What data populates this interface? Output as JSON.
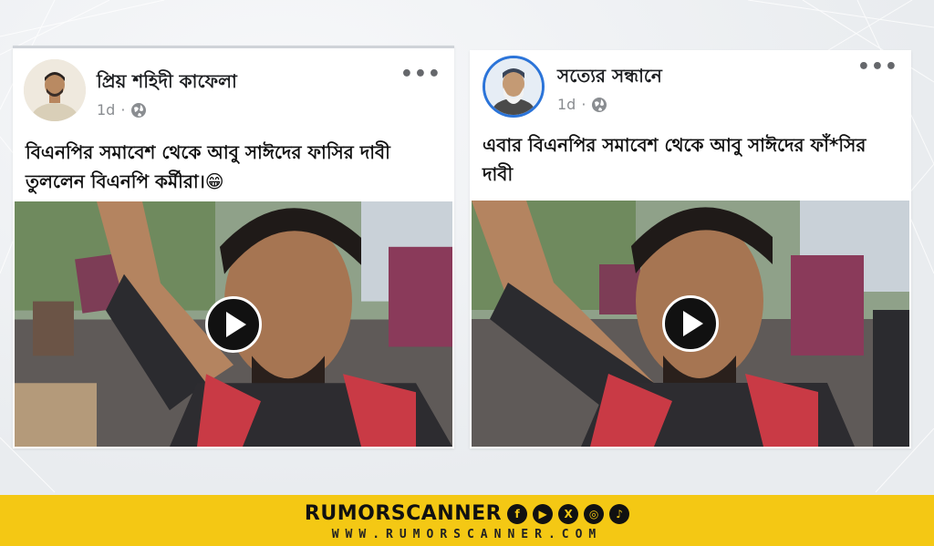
{
  "posts": [
    {
      "page_name": "প্রিয় শহিদী কাফেলা",
      "time": "1d",
      "separator": "·",
      "more_icon": "more-icon",
      "caption": "বিএনপির সমাবেশ থেকে আবু সাঈদের ফাসির দাবী তুললেন বিএনপি কর্মীরা।😁",
      "video_icon": "play-icon"
    },
    {
      "page_name": "সত্যের সন্ধানে",
      "time": "1d",
      "separator": "·",
      "more_icon": "more-icon",
      "caption": "এবার বিএনপির সমাবেশ থেকে আবু সাঈদের ফাঁ*সির দাবী",
      "video_icon": "play-icon"
    }
  ],
  "footer": {
    "brand": "RUMORSCANNER",
    "social_icons": [
      "facebook-icon",
      "youtube-icon",
      "x-icon",
      "instagram-icon",
      "tiktok-icon"
    ],
    "social_glyphs": [
      "f",
      "▶",
      "X",
      "◎",
      "♪"
    ],
    "url": "WWW.RUMORSCANNER.COM"
  },
  "colors": {
    "footer_bg": "#f4c814",
    "avatar_ring": "#2b74d9",
    "play_button": "#111111"
  }
}
